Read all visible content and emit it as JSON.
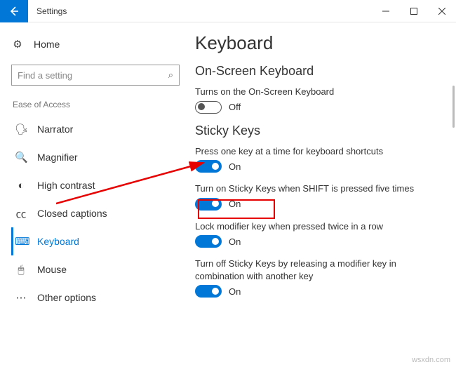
{
  "window": {
    "title": "Settings"
  },
  "sidebar": {
    "home": "Home",
    "search_placeholder": "Find a setting",
    "section": "Ease of Access",
    "items": [
      {
        "label": "Narrator"
      },
      {
        "label": "Magnifier"
      },
      {
        "label": "High contrast"
      },
      {
        "label": "Closed captions"
      },
      {
        "label": "Keyboard"
      },
      {
        "label": "Mouse"
      },
      {
        "label": "Other options"
      }
    ]
  },
  "main": {
    "h1": "Keyboard",
    "osk": {
      "h2": "On-Screen Keyboard",
      "label": "Turns on the On-Screen Keyboard",
      "state": "Off"
    },
    "sticky": {
      "h2": "Sticky Keys",
      "opt1": {
        "label": "Press one key at a time for keyboard shortcuts",
        "state": "On"
      },
      "opt2": {
        "label": "Turn on Sticky Keys when SHIFT is pressed five times",
        "state": "On"
      },
      "opt3": {
        "label": "Lock modifier key when pressed twice in a row",
        "state": "On"
      },
      "opt4": {
        "label": "Turn off Sticky Keys by releasing a modifier key in combination with another key",
        "state": "On"
      }
    }
  },
  "watermark": "wsxdn.com"
}
